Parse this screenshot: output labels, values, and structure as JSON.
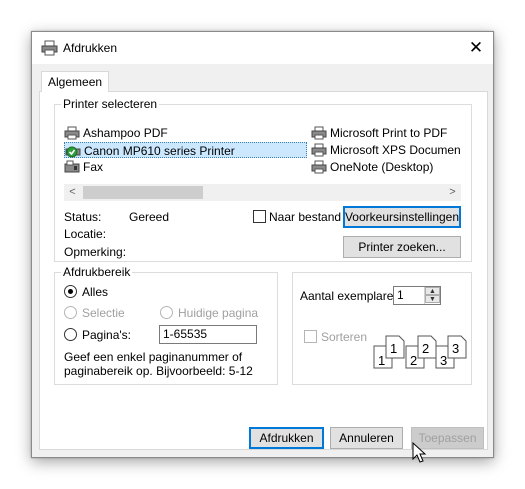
{
  "window": {
    "title": "Afdrukken",
    "close_glyph": "✕",
    "icon": "printer-icon"
  },
  "tabs": [
    {
      "label": "Algemeen"
    }
  ],
  "printer_select": {
    "legend": "Printer selecteren",
    "printers": [
      {
        "name": "Ashampoo PDF",
        "icon": "printer-icon"
      },
      {
        "name": "Canon MP610 series Printer",
        "icon": "printer-default-icon",
        "selected": true
      },
      {
        "name": "Fax",
        "icon": "fax-icon"
      },
      {
        "name": "Microsoft Print to PDF",
        "icon": "printer-icon"
      },
      {
        "name": "Microsoft XPS Documen",
        "icon": "printer-icon"
      },
      {
        "name": "OneNote (Desktop)",
        "icon": "printer-icon"
      }
    ],
    "scroll_left": "<",
    "scroll_right": ">",
    "status_label": "Status:",
    "status_value": "Gereed",
    "location_label": "Locatie:",
    "comment_label": "Opmerking:",
    "print_to_file_label": "Naar bestand",
    "preferences_button": "Voorkeursinstellingen",
    "find_printer_button": "Printer zoeken..."
  },
  "page_range": {
    "legend": "Afdrukbereik",
    "all_label": "Alles",
    "selection_label": "Selectie",
    "current_page_label": "Huidige pagina",
    "pages_label": "Pagina's:",
    "pages_value": "1-65535",
    "hint": "Geef een enkel paginanummer of paginabereik op. Bijvoorbeeld: 5-12"
  },
  "copies": {
    "count_label": "Aantal exemplaren:",
    "count_value": "1",
    "collate_label": "Sorteren",
    "collate_pages": [
      "1",
      "1",
      "2",
      "2",
      "3",
      "3"
    ]
  },
  "buttons": {
    "print": "Afdrukken",
    "cancel": "Annuleren",
    "apply": "Toepassen"
  },
  "colors": {
    "selection": "#cce8ff",
    "focus": "#0078d7",
    "annotation_arrow": "#e3262b"
  }
}
